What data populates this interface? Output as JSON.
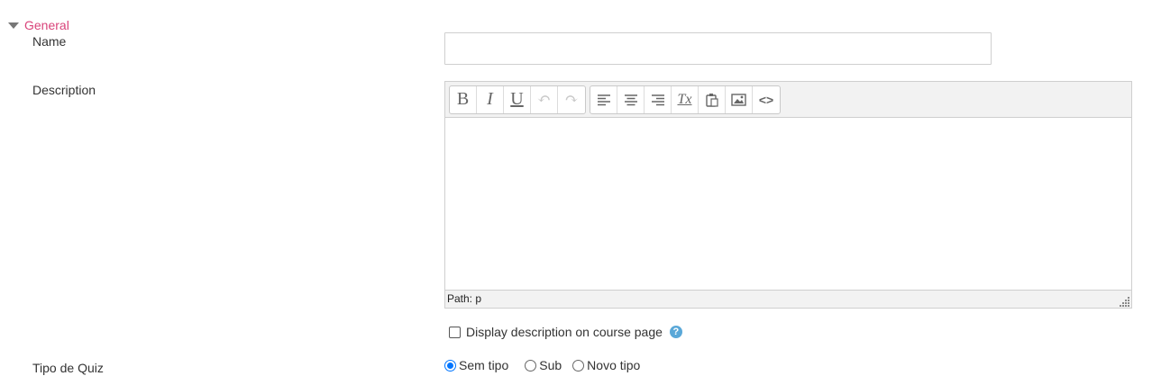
{
  "section": {
    "title": "General"
  },
  "name_field": {
    "label": "Name",
    "value": "",
    "placeholder": ""
  },
  "description": {
    "label": "Description",
    "toolbar": {
      "group1": [
        {
          "icon": "bold-icon",
          "glyph": "B",
          "enabled": true
        },
        {
          "icon": "italic-icon",
          "glyph": "I",
          "enabled": true
        },
        {
          "icon": "underline-icon",
          "glyph": "U",
          "enabled": true
        },
        {
          "icon": "undo-icon",
          "glyph": "↶",
          "enabled": false
        },
        {
          "icon": "redo-icon",
          "glyph": "↷",
          "enabled": false
        }
      ],
      "group2": [
        {
          "icon": "align-left-icon",
          "enabled": true
        },
        {
          "icon": "align-center-icon",
          "enabled": true
        },
        {
          "icon": "align-right-icon",
          "enabled": true
        },
        {
          "icon": "clear-formatting-icon",
          "glyph": "Tx",
          "enabled": true
        },
        {
          "icon": "paste-icon",
          "enabled": true
        },
        {
          "icon": "image-icon",
          "enabled": true
        },
        {
          "icon": "code-icon",
          "glyph": "<>",
          "enabled": true
        }
      ]
    },
    "path_text": "Path: p"
  },
  "display_description": {
    "label": "Display description on course page",
    "checked": false
  },
  "quiz_type": {
    "label": "Tipo de Quiz",
    "options": [
      {
        "label": "Sem tipo",
        "checked": true
      },
      {
        "label": "Sub",
        "checked": false
      },
      {
        "label": "Novo tipo",
        "checked": false
      }
    ]
  },
  "colors": {
    "accent": "#d9437a",
    "help": "#5aa8d8",
    "radio": "#0075ff"
  }
}
